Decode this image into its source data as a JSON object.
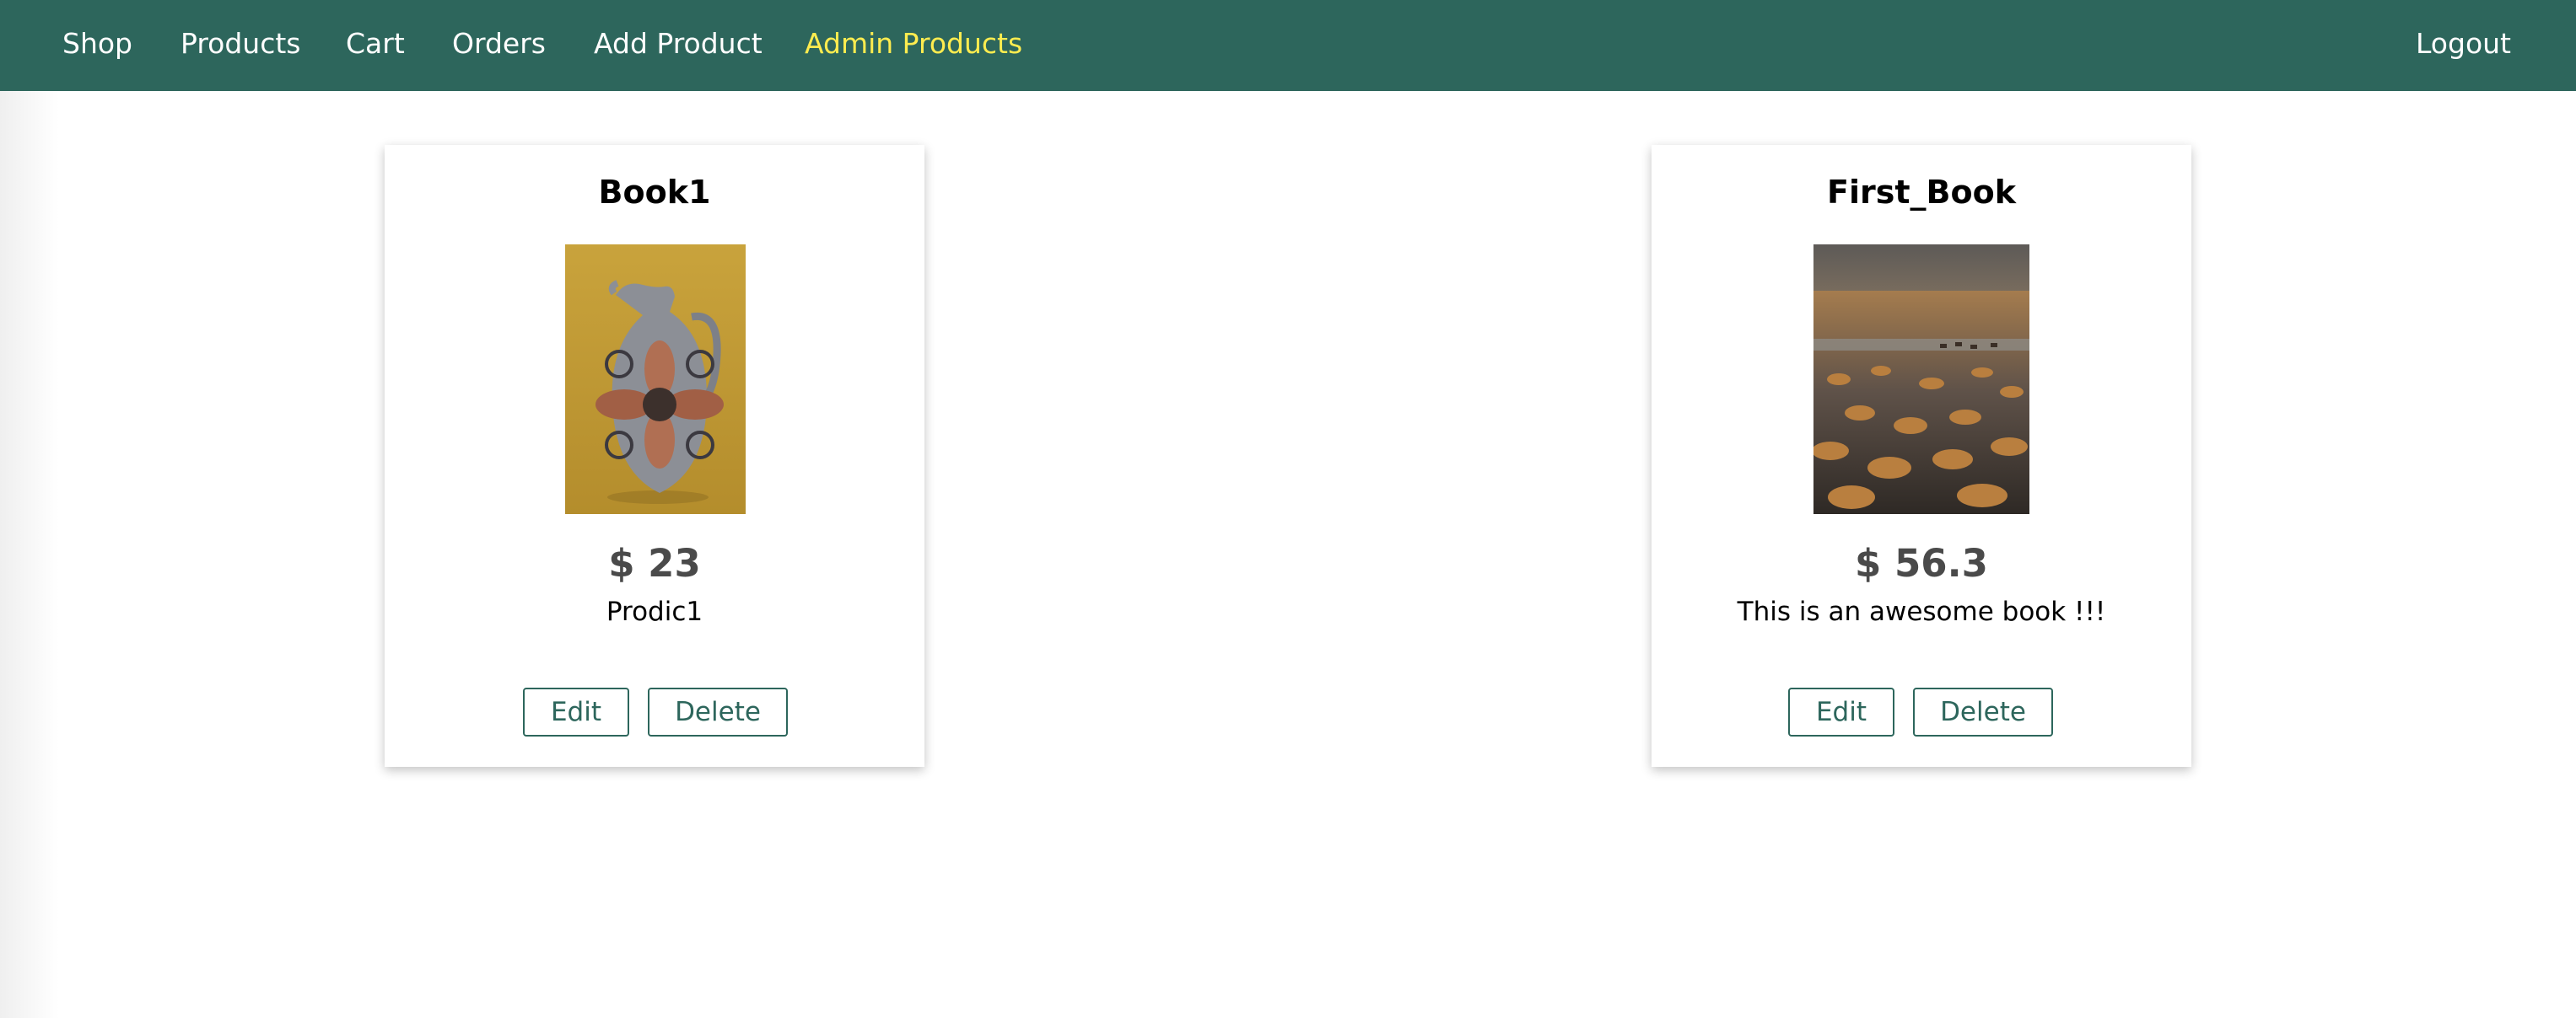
{
  "nav": {
    "items": [
      {
        "label": "Shop"
      },
      {
        "label": "Products"
      },
      {
        "label": "Cart"
      },
      {
        "label": "Orders"
      },
      {
        "label": "Add Product"
      },
      {
        "label": "Admin Products",
        "active": true
      }
    ],
    "logout": "Logout"
  },
  "colors": {
    "nav_background": "#2d665c",
    "active_link": "#ffec4f",
    "button_border": "#2d665c"
  },
  "products": [
    {
      "title": "Book1",
      "price": "$ 23",
      "description": "Prodic1",
      "image_alt": "ceramic jug on yellow background",
      "edit_label": "Edit",
      "delete_label": "Delete"
    },
    {
      "title": "First_Book",
      "price": "$ 56.3",
      "description": "This is an awesome book !!!",
      "image_alt": "desert landscape with grass tufts",
      "edit_label": "Edit",
      "delete_label": "Delete"
    }
  ]
}
